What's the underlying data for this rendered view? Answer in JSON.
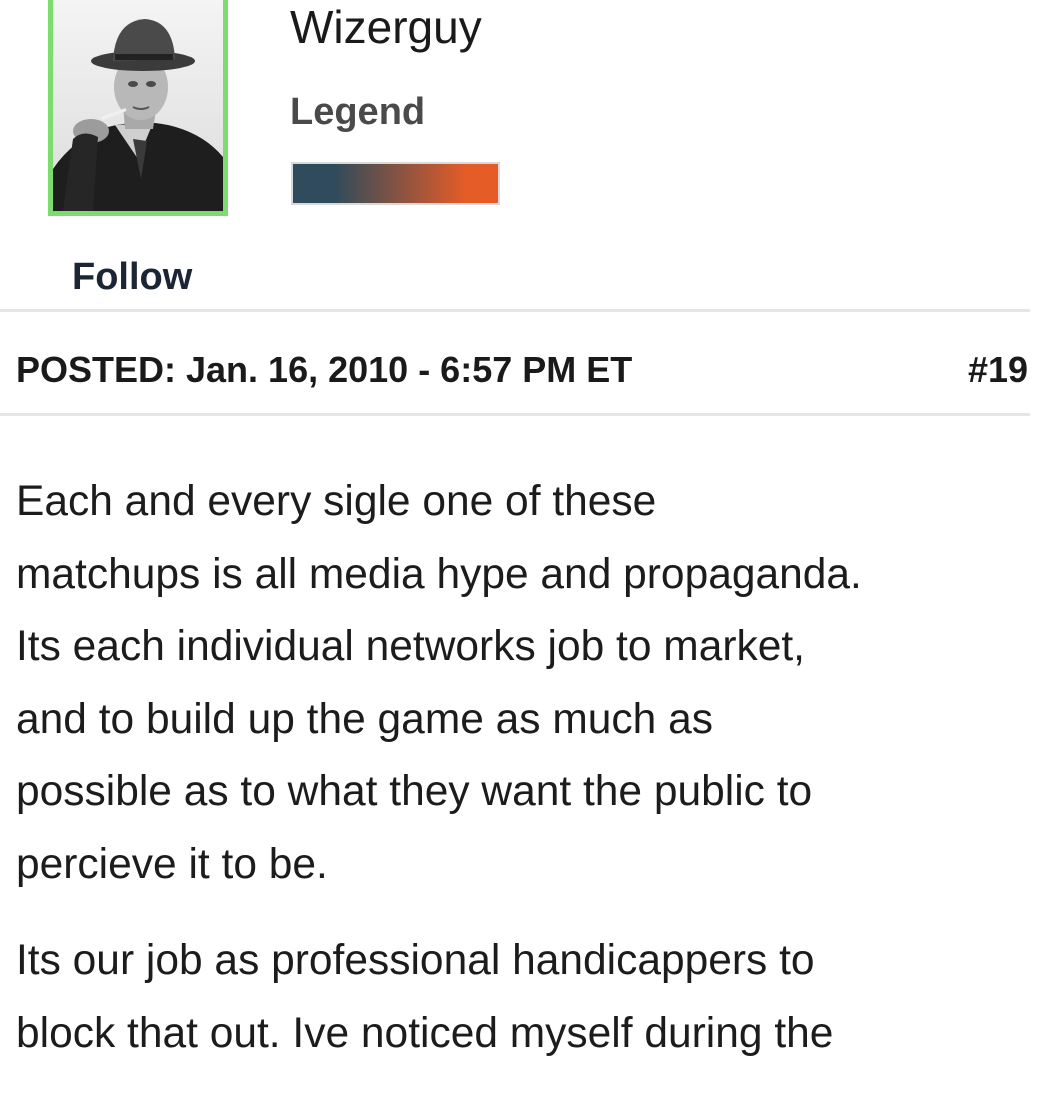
{
  "profile": {
    "username": "Wizerguy",
    "rank": "Legend",
    "avatar_icon": "fedora-man-photo",
    "avatar_border_color": "#7ddc6e",
    "rank_bar_colors": [
      "#2f4b5c",
      "#e65c27"
    ],
    "follow_label": "Follow"
  },
  "post": {
    "posted_label": "POSTED: Jan. 16, 2010 - 6:57 PM ET",
    "post_number": "#19",
    "paragraphs": [
      "Each and every sigle one of these\nmatchups is all media hype and propaganda.\nIts each individual networks job to market,\nand to build up the game as much as\npossible as to what they want the public to\npercieve it to be.",
      "Its our job as  professional  handicappers to\nblock that out. Ive noticed myself during the"
    ]
  }
}
